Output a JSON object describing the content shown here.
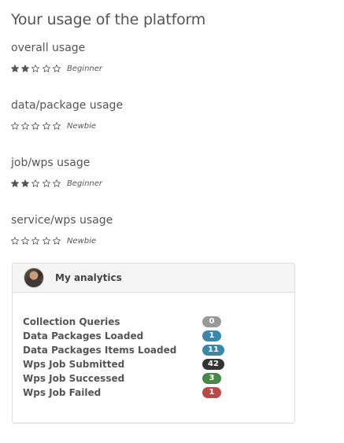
{
  "page": {
    "title": "Your usage of the platform"
  },
  "usage": [
    {
      "label": "overall usage",
      "rating": 2,
      "max": 5,
      "level": "Beginner"
    },
    {
      "label": "data/package usage",
      "rating": 0,
      "max": 5,
      "level": "Newbie"
    },
    {
      "label": "job/wps usage",
      "rating": 2,
      "max": 5,
      "level": "Beginner"
    },
    {
      "label": "service/wps usage",
      "rating": 0,
      "max": 5,
      "level": "Newbie"
    }
  ],
  "analytics": {
    "title": "My analytics",
    "avatar_icon": "user-avatar",
    "stats": [
      {
        "label": "Collection Queries",
        "value": "0",
        "color": "#999999"
      },
      {
        "label": "Data Packages Loaded",
        "value": "1",
        "color": "#3a87ad"
      },
      {
        "label": "Data Packages Items Loaded",
        "value": "11",
        "color": "#3a87ad"
      },
      {
        "label": "Wps Job Submitted",
        "value": "42",
        "color": "#333333"
      },
      {
        "label": "Wps Job Successed",
        "value": "3",
        "color": "#468847"
      },
      {
        "label": "Wps Job Failed",
        "value": "1",
        "color": "#b94a48"
      }
    ]
  },
  "colors": {
    "star": "#555555",
    "text": "#555555"
  }
}
